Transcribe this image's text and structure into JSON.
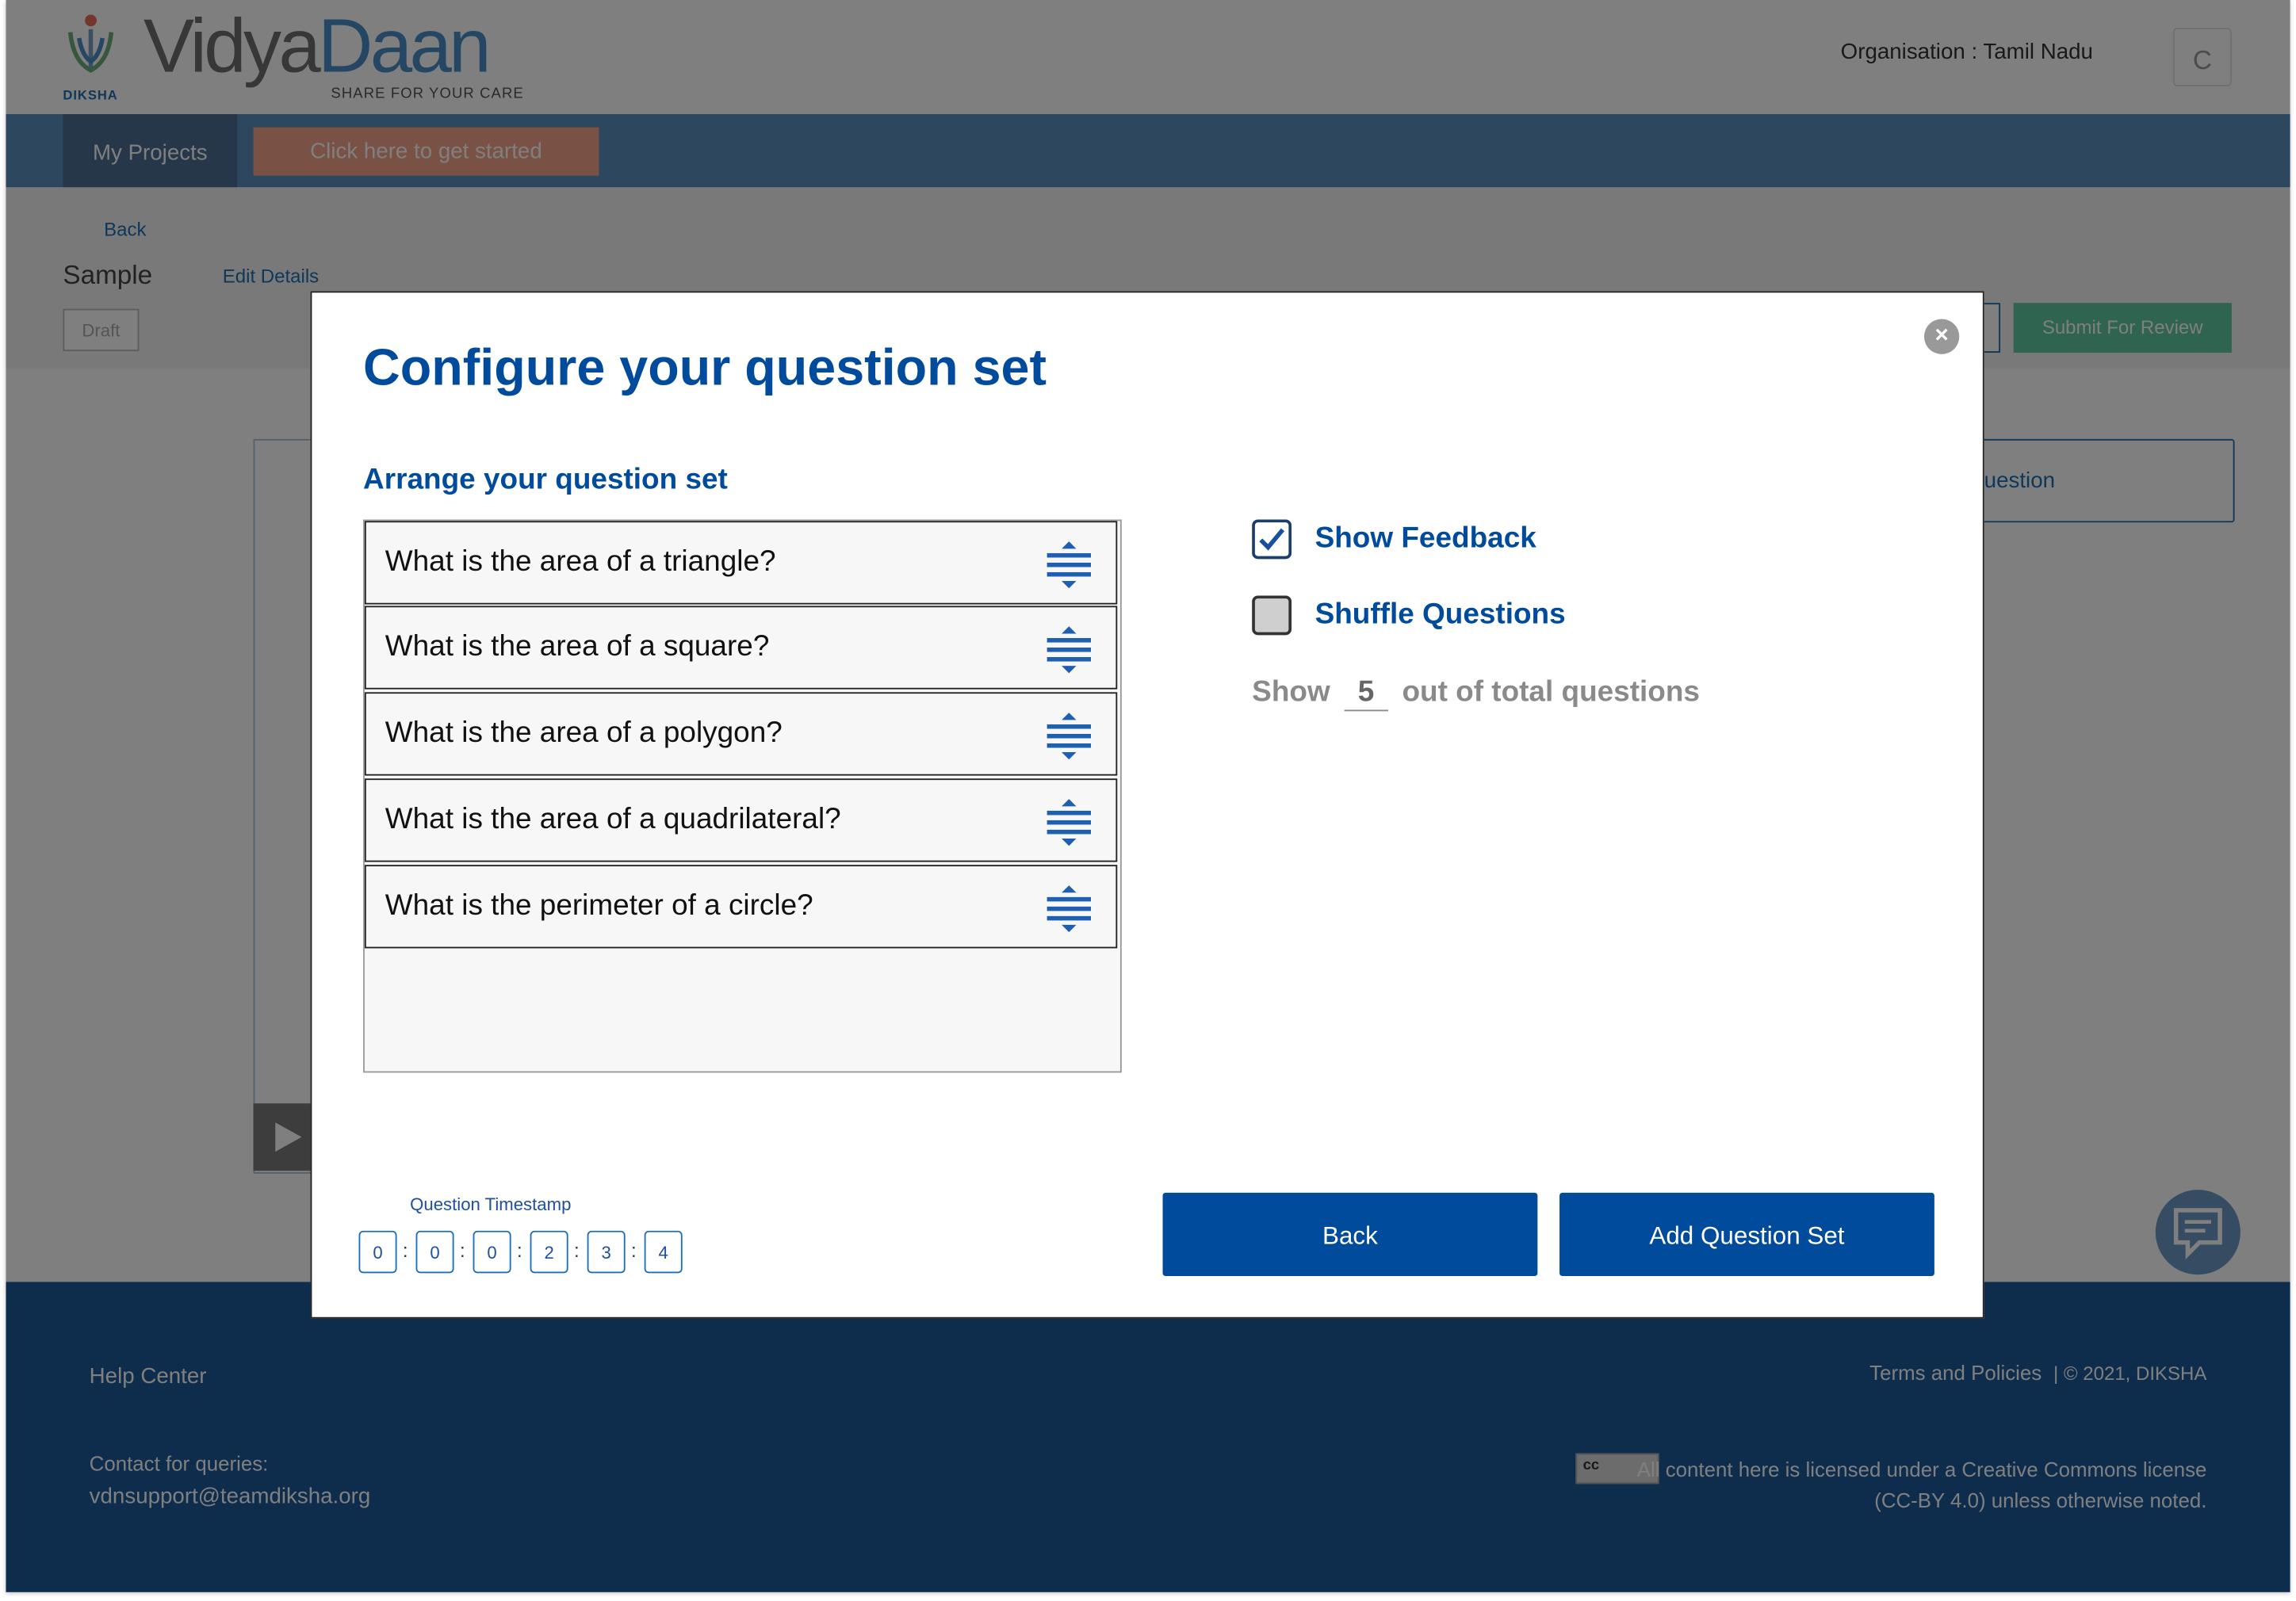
{
  "header": {
    "logo_sub": "DIKSHA",
    "logo_vidya": "Vidya",
    "logo_daan": "Daan",
    "logo_tagline": "SHARE FOR YOUR CARE",
    "organisation": "Organisation : Tamil Nadu",
    "avatar_initial": "C"
  },
  "nav": {
    "my_projects": "My Projects",
    "cta": "Click here to get started"
  },
  "page": {
    "back": "Back",
    "title": "Sample",
    "edit_details": "Edit Details",
    "status_badge": "Draft",
    "submit_for_review": "Submit For Review",
    "question_button_partial": "uestion"
  },
  "modal": {
    "title": "Configure your question set",
    "arrange_label": "Arrange your question set",
    "questions": [
      "What is the area of a triangle?",
      "What is the area of a square?",
      "What is the area of a polygon?",
      "What is the area of a quadrilateral?",
      "What is the perimeter of a circle?"
    ],
    "show_feedback": {
      "label": "Show Feedback",
      "checked": true
    },
    "shuffle_questions": {
      "label": "Shuffle Questions",
      "checked": false
    },
    "show_count": {
      "prefix": "Show",
      "value": "5",
      "suffix": "out of total questions"
    },
    "timestamp": {
      "label": "Question Timestamp",
      "digits": [
        "0",
        "0",
        "0",
        "2",
        "3",
        "4"
      ]
    },
    "back_button": "Back",
    "add_button": "Add Question Set"
  },
  "footer": {
    "help_center": "Help Center",
    "contact_label": "Contact for queries:",
    "contact_email": "vdnsupport@teamdiksha.org",
    "terms": "Terms and Policies",
    "copyright": "| © 2021, DIKSHA",
    "cc_badge": "cc",
    "license": "All content here is licensed under a Creative Commons license (CC-BY 4.0) unless otherwise noted."
  },
  "colors": {
    "brand_blue": "#004b9c",
    "nav_blue": "#5b8fbe",
    "footer_blue": "#1c5a9a",
    "cta_orange": "#f4a58a",
    "submit_green": "#5cc8a0"
  }
}
